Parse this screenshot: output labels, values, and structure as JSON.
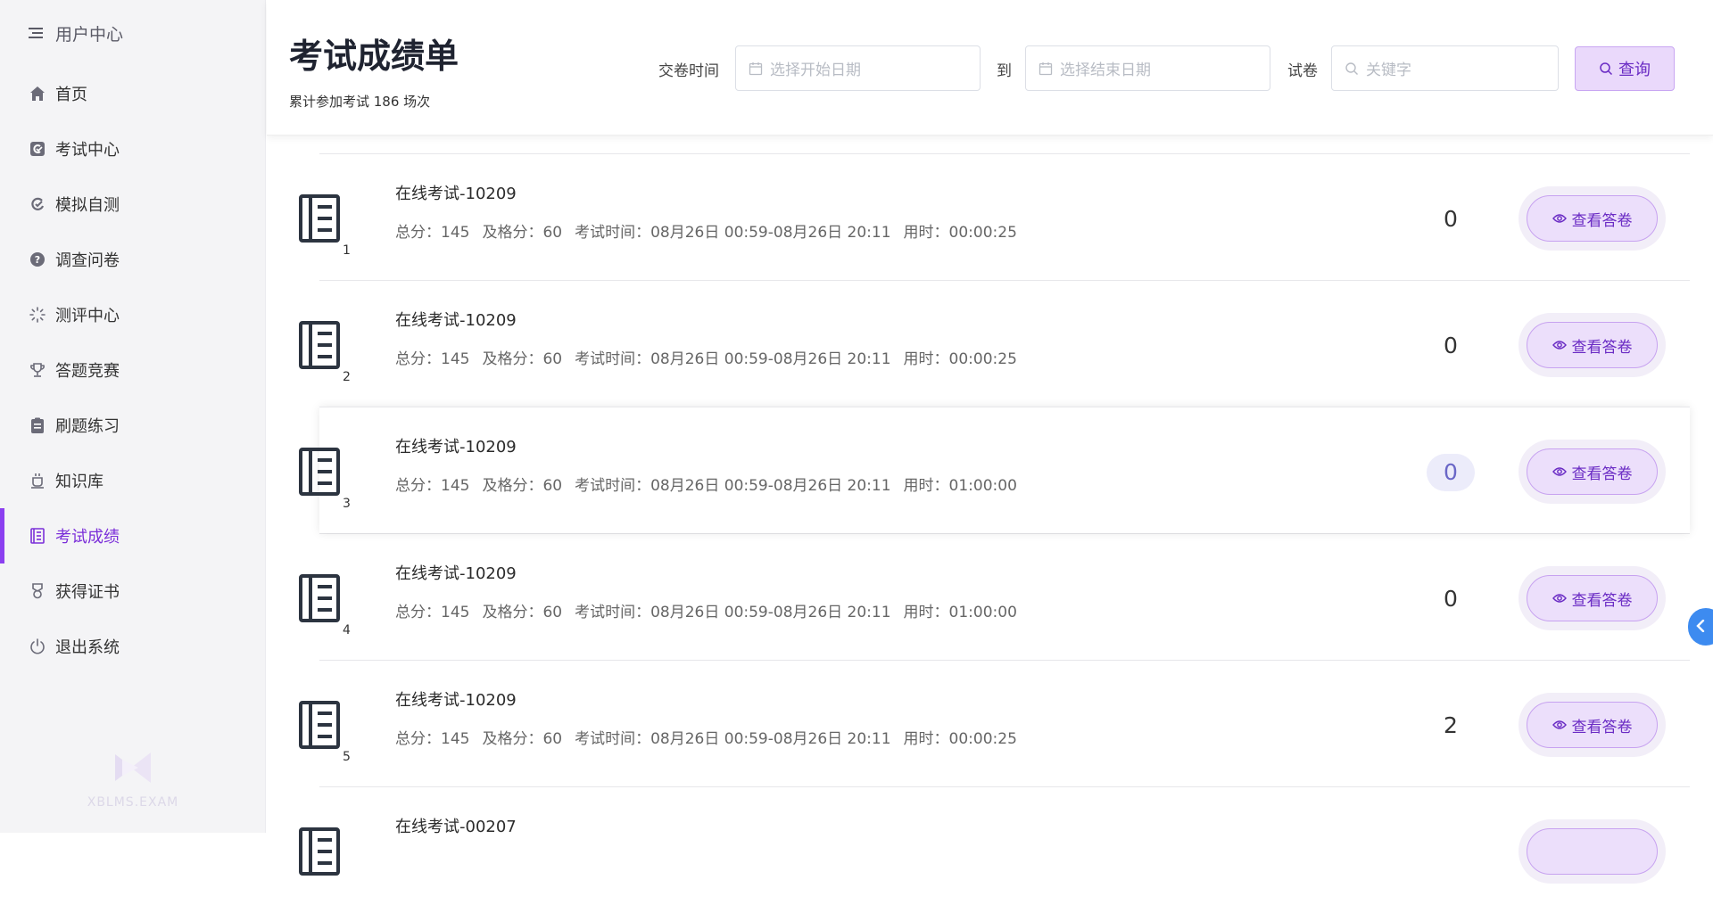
{
  "sidebar": {
    "header": "用户中心",
    "items": [
      {
        "label": "首页",
        "icon": "home-icon"
      },
      {
        "label": "考试中心",
        "icon": "exam-icon"
      },
      {
        "label": "模拟自测",
        "icon": "self-test-icon"
      },
      {
        "label": "调查问卷",
        "icon": "question-icon"
      },
      {
        "label": "测评中心",
        "icon": "loading-icon"
      },
      {
        "label": "答题竞赛",
        "icon": "trophy-icon"
      },
      {
        "label": "刷题练习",
        "icon": "clipboard-icon"
      },
      {
        "label": "知识库",
        "icon": "cup-icon"
      },
      {
        "label": "考试成绩",
        "icon": "report-icon",
        "active": true
      },
      {
        "label": "获得证书",
        "icon": "medal-icon"
      },
      {
        "label": "退出系统",
        "icon": "power-icon"
      }
    ],
    "brand": "XBLMS.EXAM"
  },
  "header": {
    "title": "考试成绩单",
    "subtitle": "累计参加考试 186 场次",
    "submit_time_label": "交卷时间",
    "start_placeholder": "选择开始日期",
    "to_label": "到",
    "end_placeholder": "选择结束日期",
    "paper_label": "试卷",
    "keyword_placeholder": "关键字",
    "search_button": "查询"
  },
  "rows": [
    {
      "index": "1",
      "title": "在线考试-10209",
      "total": "总分：145",
      "pass": "及格分：60",
      "time": "考试时间：08月26日 00:59-08月26日 20:11",
      "duration": "用时：00:00:25",
      "score": "0",
      "action": "查看答卷"
    },
    {
      "index": "2",
      "title": "在线考试-10209",
      "total": "总分：145",
      "pass": "及格分：60",
      "time": "考试时间：08月26日 00:59-08月26日 20:11",
      "duration": "用时：00:00:25",
      "score": "0",
      "action": "查看答卷"
    },
    {
      "index": "3",
      "title": "在线考试-10209",
      "total": "总分：145",
      "pass": "及格分：60",
      "time": "考试时间：08月26日 00:59-08月26日 20:11",
      "duration": "用时：01:00:00",
      "score": "0",
      "action": "查看答卷"
    },
    {
      "index": "4",
      "title": "在线考试-10209",
      "total": "总分：145",
      "pass": "及格分：60",
      "time": "考试时间：08月26日 00:59-08月26日 20:11",
      "duration": "用时：01:00:00",
      "score": "0",
      "action": "查看答卷"
    },
    {
      "index": "5",
      "title": "在线考试-10209",
      "total": "总分：145",
      "pass": "及格分：60",
      "time": "考试时间：08月26日 00:59-08月26日 20:11",
      "duration": "用时：00:00:25",
      "score": "2",
      "action": "查看答卷"
    },
    {
      "index": "",
      "title": "在线考试-00207",
      "total": "",
      "pass": "",
      "time": "",
      "duration": "",
      "score": "",
      "action": ""
    }
  ]
}
